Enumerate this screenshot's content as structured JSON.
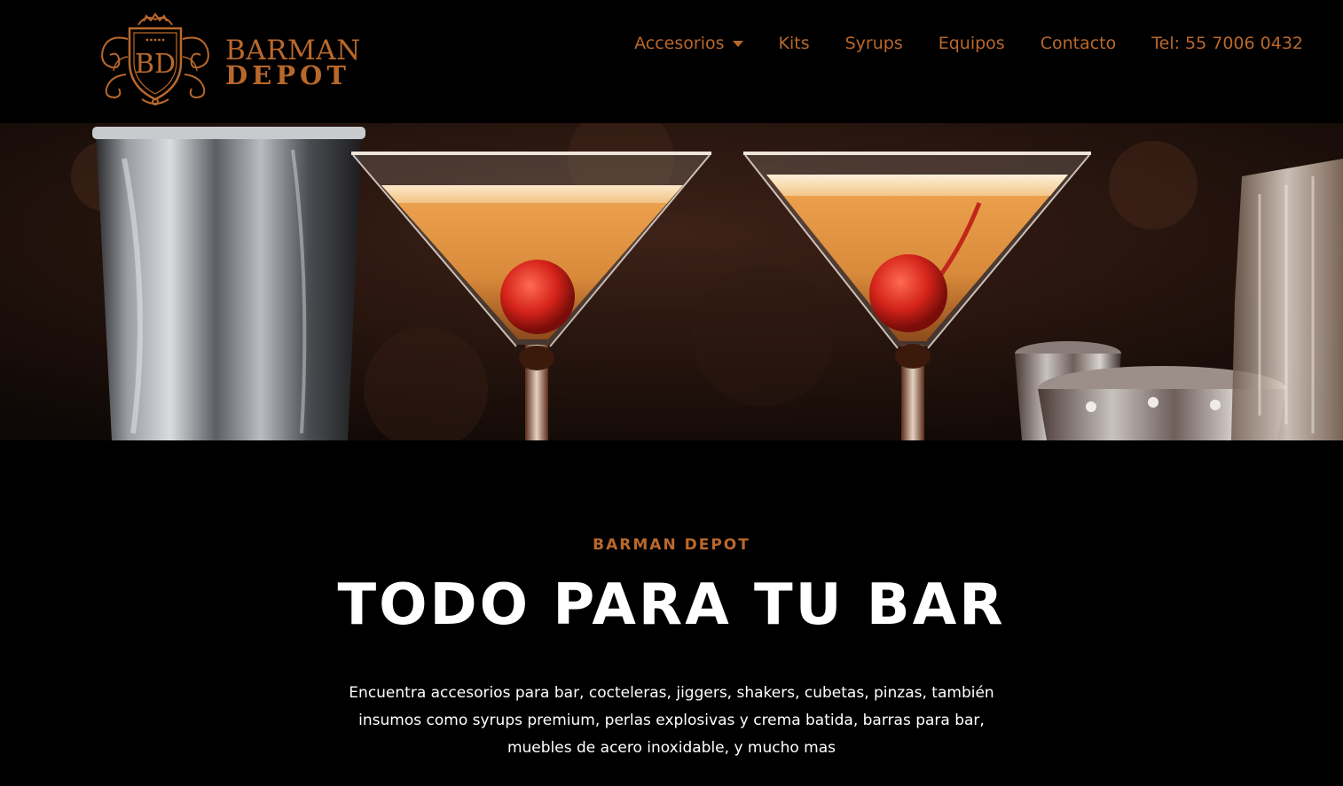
{
  "brand": {
    "monogram": "BD",
    "name_line1": "BARMAN",
    "name_line2": "DEPOT",
    "accent_color": "#b9682c"
  },
  "nav": {
    "items": [
      {
        "label": "Accesorios",
        "has_dropdown": true
      },
      {
        "label": "Kits"
      },
      {
        "label": "Syrups"
      },
      {
        "label": "Equipos"
      },
      {
        "label": "Contacto"
      },
      {
        "label": "Tel: 55 7006 0432"
      }
    ],
    "dropdown_icon": "caret-down-icon"
  },
  "hero": {
    "image_subject": "two orange martini cocktails with cherries beside a cocktail shaker and jiggers on a bar"
  },
  "intro": {
    "eyebrow": "BARMAN DEPOT",
    "headline": "TODO PARA TU BAR",
    "description": "Encuentra accesorios para bar, cocteleras, jiggers, shakers, cubetas, pinzas, también insumos como syrups premium, perlas explosivas y crema batida, barras para bar, muebles de acero inoxidable, y mucho mas"
  }
}
